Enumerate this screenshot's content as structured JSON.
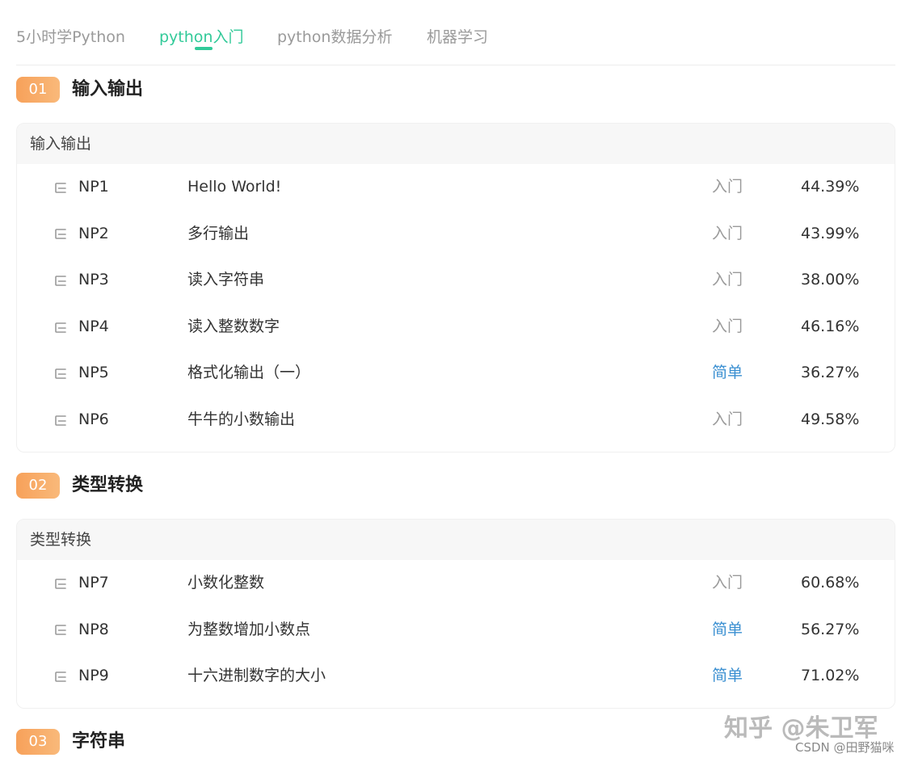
{
  "tabs": [
    {
      "label": "5小时学Python",
      "active": false
    },
    {
      "label": "python入门",
      "active": true
    },
    {
      "label": "python数据分析",
      "active": false
    },
    {
      "label": "机器学习",
      "active": false
    }
  ],
  "sections": [
    {
      "number": "01",
      "title": "输入输出",
      "card_title": "输入输出",
      "rows": [
        {
          "id": "NP1",
          "title": "Hello World!",
          "level": "入门",
          "rate": "44.39%"
        },
        {
          "id": "NP2",
          "title": "多行输出",
          "level": "入门",
          "rate": "43.99%"
        },
        {
          "id": "NP3",
          "title": "读入字符串",
          "level": "入门",
          "rate": "38.00%"
        },
        {
          "id": "NP4",
          "title": "读入整数数字",
          "level": "入门",
          "rate": "46.16%"
        },
        {
          "id": "NP5",
          "title": "格式化输出（一）",
          "level": "简单",
          "rate": "36.27%"
        },
        {
          "id": "NP6",
          "title": "牛牛的小数输出",
          "level": "入门",
          "rate": "49.58%"
        }
      ]
    },
    {
      "number": "02",
      "title": "类型转换",
      "card_title": "类型转换",
      "rows": [
        {
          "id": "NP7",
          "title": "小数化整数",
          "level": "入门",
          "rate": "60.68%"
        },
        {
          "id": "NP8",
          "title": "为整数增加小数点",
          "level": "简单",
          "rate": "56.27%"
        },
        {
          "id": "NP9",
          "title": "十六进制数字的大小",
          "level": "简单",
          "rate": "71.02%"
        }
      ]
    },
    {
      "number": "03",
      "title": "字符串"
    }
  ],
  "watermark": {
    "zhihu": "知乎 @朱卫军",
    "csdn": "CSDN @田野猫咪"
  },
  "colors": {
    "accent": "#32ca99",
    "badge": "#f7a15a",
    "easy": "#3a8fd1"
  }
}
